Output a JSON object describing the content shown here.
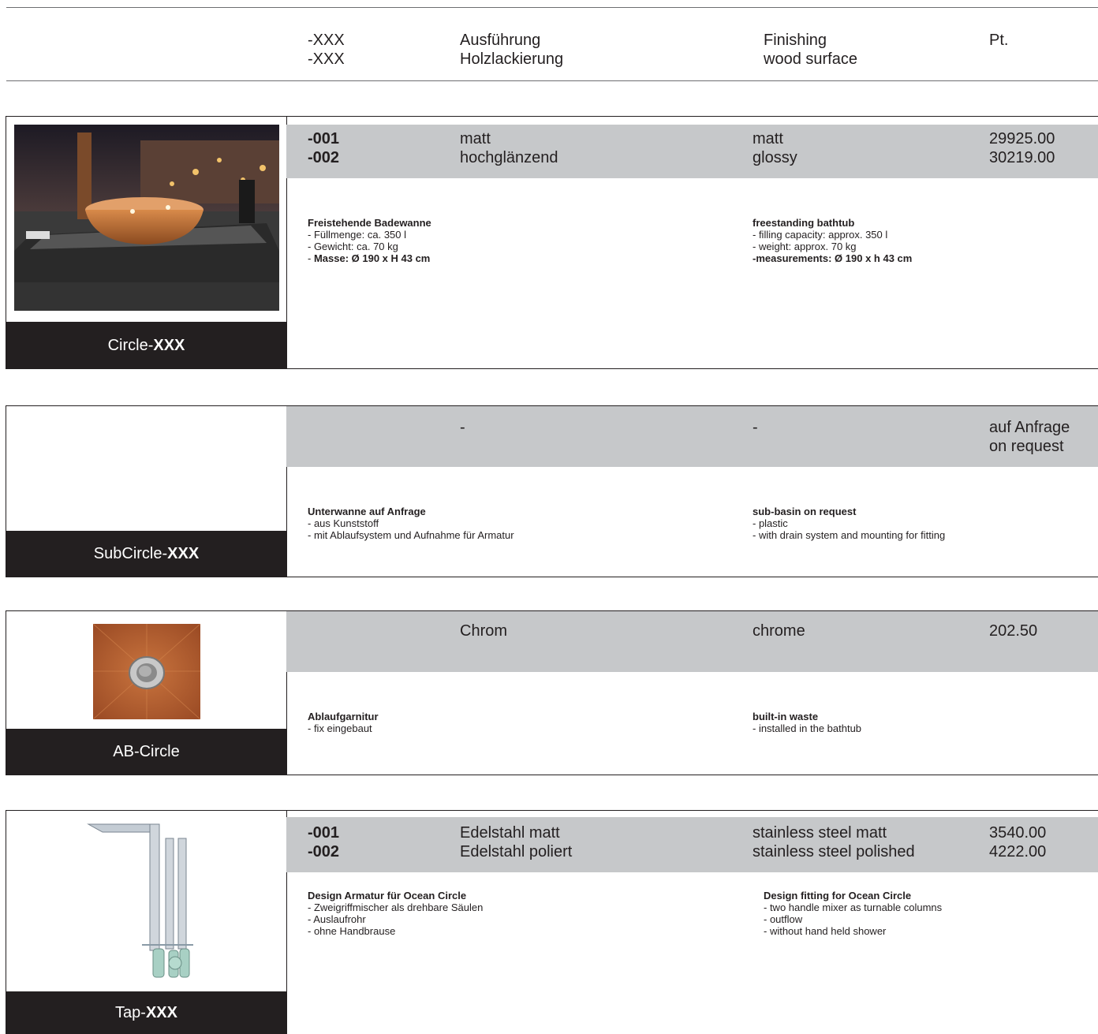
{
  "header": {
    "codes": [
      "-XXX",
      "-XXX"
    ],
    "de": [
      "Ausführung",
      "Holzlackierung"
    ],
    "en": [
      "Finishing",
      "wood surface"
    ],
    "pt": "Pt."
  },
  "sections": [
    {
      "label_prefix": "Circle-",
      "label_bold": "XXX",
      "codes": [
        "-001",
        "-002"
      ],
      "de_options": [
        "matt",
        "hochglänzend"
      ],
      "en_options": [
        "matt",
        "glossy"
      ],
      "prices": [
        "29925.00",
        "30219.00"
      ],
      "de_title": "Freistehende Badewanne",
      "de_lines": [
        "- Füllmenge: ca. 350 l",
        "- Gewicht: ca. 70 kg"
      ],
      "de_bold_prefix": "- ",
      "de_bold_line": "Masse: Ø 190 x H 43 cm",
      "en_title": "freestanding bathtub",
      "en_lines": [
        "- filling capacity: approx. 350 l",
        "- weight: approx. 70 kg"
      ],
      "en_bold_line": "-measurements: Ø 190 x h 43 cm"
    },
    {
      "label_prefix": "SubCircle-",
      "label_bold": "XXX",
      "de_option": "-",
      "en_option": "-",
      "price_lines": [
        "auf Anfrage",
        "on request"
      ],
      "de_title": "Unterwanne auf Anfrage",
      "de_lines": [
        "- aus Kunststoff",
        "- mit Ablaufsystem und Aufnahme für Armatur"
      ],
      "en_title": "sub-basin on request",
      "en_lines": [
        "- plastic",
        "- with drain system and mounting for fitting"
      ]
    },
    {
      "label": "AB-Circle",
      "de_option": "Chrom",
      "en_option": "chrome",
      "price": "202.50",
      "de_title": "Ablaufgarnitur",
      "de_lines": [
        "- fix eingebaut"
      ],
      "en_title": "built-in waste",
      "en_lines": [
        "- installed in the bathtub"
      ]
    },
    {
      "label_prefix": "Tap-",
      "label_bold": "XXX",
      "codes": [
        "-001",
        "-002"
      ],
      "de_options": [
        "Edelstahl matt",
        "Edelstahl poliert"
      ],
      "en_options": [
        "stainless steel matt",
        "stainless steel polished"
      ],
      "prices": [
        "3540.00",
        "4222.00"
      ],
      "de_title": "Design Armatur für Ocean Circle",
      "de_lines": [
        "- Zweigriffmischer als drehbare Säulen",
        "- Auslaufrohr",
        "- ohne Handbrause"
      ],
      "en_title": "Design fitting for Ocean Circle",
      "en_lines": [
        "- two handle mixer as turnable columns",
        "- outflow",
        "- without hand held shower"
      ]
    }
  ],
  "colors": {
    "dark": "#231f20",
    "gray_band": "#c6c8ca",
    "wood": "#b5622e"
  }
}
